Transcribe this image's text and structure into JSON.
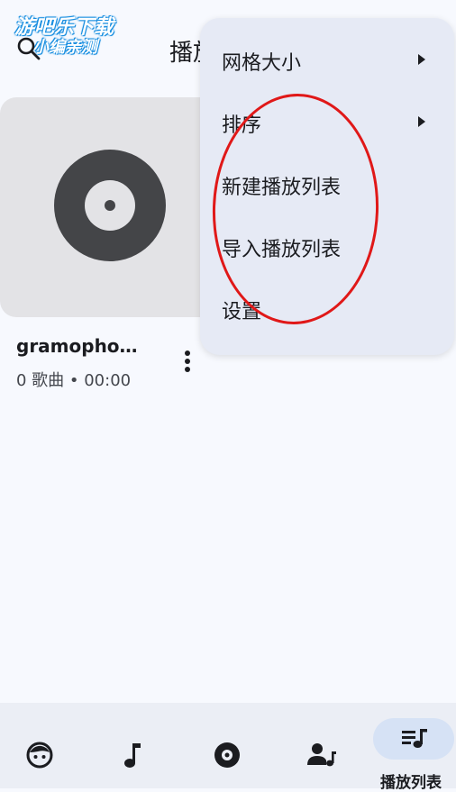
{
  "watermark": {
    "line1": "游吧乐下载",
    "line2": "小编亲测"
  },
  "header": {
    "title": "播放列表"
  },
  "playlist_card": {
    "title": "gramopho…",
    "subtitle": "0 歌曲 • 00:00"
  },
  "menu": {
    "items": [
      {
        "label": "网格大小",
        "has_submenu": true
      },
      {
        "label": "排序",
        "has_submenu": true
      },
      {
        "label": "新建播放列表",
        "has_submenu": false
      },
      {
        "label": "导入播放列表",
        "has_submenu": false
      },
      {
        "label": "设置",
        "has_submenu": false
      }
    ]
  },
  "bottom_nav": {
    "items": [
      {
        "icon": "face-icon"
      },
      {
        "icon": "music-note-icon"
      },
      {
        "icon": "album-icon"
      },
      {
        "icon": "artist-icon"
      },
      {
        "icon": "playlist-icon",
        "label": "播放列表",
        "active": true
      }
    ]
  },
  "colors": {
    "background": "#f7f9fe",
    "menu_bg": "#e6eaf5",
    "annotation": "#e01818",
    "active_pill": "#d6e2f5"
  }
}
